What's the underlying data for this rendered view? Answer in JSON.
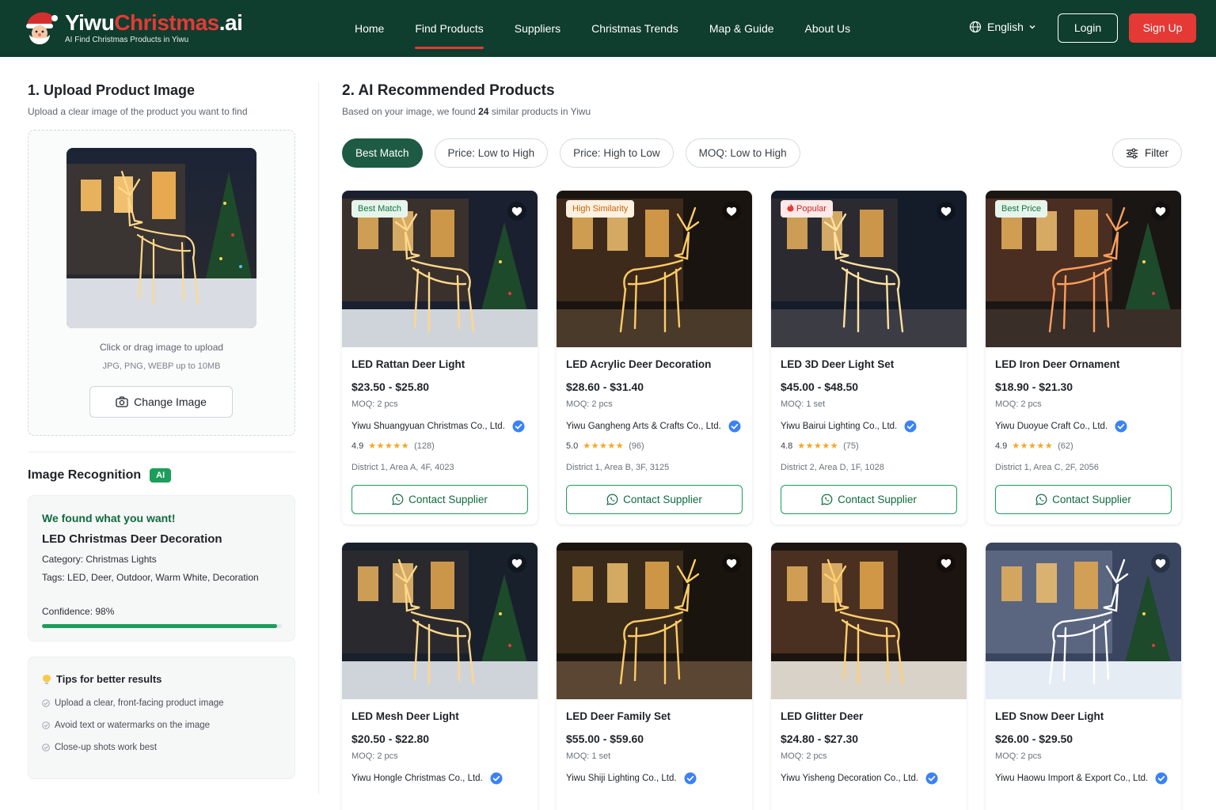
{
  "header": {
    "logo_part1": "Yiwu",
    "logo_part2": "Christmas",
    "logo_part3": ".ai",
    "logo_sub": "AI Find Christmas Products in Yiwu",
    "nav": [
      {
        "label": "Home"
      },
      {
        "label": "Find Products"
      },
      {
        "label": "Suppliers"
      },
      {
        "label": "Christmas Trends"
      },
      {
        "label": "Map & Guide"
      },
      {
        "label": "About Us"
      }
    ],
    "active_nav": "Find Products",
    "language": "English",
    "login": "Login",
    "signup": "Sign Up"
  },
  "upload": {
    "title": "1. Upload Product Image",
    "subtitle": "Upload a clear image of the product you want to find",
    "hint": "Click or drag image to upload",
    "formats": "JPG, PNG, WEBP up to 10MB",
    "change_button": "Change Image"
  },
  "recognition": {
    "title": "Image Recognition",
    "badge": "AI",
    "found": "We found what you want!",
    "product_name": "LED Christmas Deer Decoration",
    "category": "Category: Christmas Lights",
    "tags": "Tags: LED, Deer, Outdoor, Warm White, Decoration",
    "confidence_label": "Confidence: 98%",
    "confidence_value": 0.98
  },
  "tips": {
    "title": "Tips for better results",
    "items": [
      {
        "text": "Upload a clear, front-facing product image"
      },
      {
        "text": "Avoid text or watermarks on the image"
      },
      {
        "text": "Close-up shots work best"
      }
    ]
  },
  "results": {
    "title": "2. AI Recommended Products",
    "subtitle_prefix": "Based on your image, we found",
    "count": "24",
    "subtitle_suffix": "similar products in Yiwu",
    "sort_options": [
      {
        "label": "Best Match"
      },
      {
        "label": "Price: Low to High"
      },
      {
        "label": "Price: High to Low"
      },
      {
        "label": "MOQ: Low to High"
      }
    ],
    "active_sort": "Best Match",
    "filter_label": "Filter",
    "contact_label": "Contact Supplier"
  },
  "products": [
    {
      "name": "LED Rattan Deer Light",
      "price": "$23.50 - $25.80",
      "moq": "MOQ: 2 pcs",
      "supplier": "Yiwu Shuangyuan Christmas Co., Ltd.",
      "rating": "4.9",
      "stars": "★★★★★",
      "reviews": "(128)",
      "location": "District 1, Area A, 4F, 4023",
      "badge": "Best Match",
      "badge_style": "green"
    },
    {
      "name": "LED Acrylic Deer Decoration",
      "price": "$28.60 - $31.40",
      "moq": "MOQ: 2 pcs",
      "supplier": "Yiwu Gangheng Arts & Crafts Co., Ltd.",
      "rating": "5.0",
      "stars": "★★★★★",
      "reviews": "(96)",
      "location": "District 1, Area B, 3F, 3125",
      "badge": "High Similarity",
      "badge_style": "orange"
    },
    {
      "name": "LED 3D Deer Light Set",
      "price": "$45.00 - $48.50",
      "moq": "MOQ: 1 set",
      "supplier": "Yiwu Bairui Lighting Co., Ltd.",
      "rating": "4.8",
      "stars": "★★★★★",
      "reviews": "(75)",
      "location": "District 2, Area D, 1F, 1028",
      "badge": "Popular",
      "badge_style": "red"
    },
    {
      "name": "LED Iron Deer Ornament",
      "price": "$18.90 - $21.30",
      "moq": "MOQ: 2 pcs",
      "supplier": "Yiwu Duoyue Craft Co., Ltd.",
      "rating": "4.9",
      "stars": "★★★★★",
      "reviews": "(62)",
      "location": "District 1, Area C, 2F, 2056",
      "badge": "Best Price",
      "badge_style": "green"
    },
    {
      "name": "LED Mesh Deer Light",
      "price": "$20.50 - $22.80",
      "moq": "MOQ: 2 pcs",
      "supplier": "Yiwu Hongle Christmas Co., Ltd."
    },
    {
      "name": "LED Deer Family Set",
      "price": "$55.00 - $59.60",
      "moq": "MOQ: 1 set",
      "supplier": "Yiwu Shiji Lighting Co., Ltd."
    },
    {
      "name": "LED Glitter Deer",
      "price": "$24.80 - $27.30",
      "moq": "MOQ: 2 pcs",
      "supplier": "Yiwu Yisheng Decoration Co., Ltd."
    },
    {
      "name": "LED Snow Deer Light",
      "price": "$26.00 - $29.50",
      "moq": "MOQ: 2 pcs",
      "supplier": "Yiwu Haowu Import & Export Co., Ltd."
    }
  ],
  "colors": {
    "header_bg": "#0f3d2e",
    "accent_red": "#e53935",
    "accent_green": "#1b9e5a",
    "active_chip": "#1d5b44",
    "star": "#f5a623",
    "verified": "#3b82f6"
  },
  "icons": [
    "santa-logo-icon",
    "globe-icon",
    "chevron-down-icon",
    "camera-icon",
    "lightbulb-icon",
    "check-circle-icon",
    "filter-icon",
    "heart-icon",
    "verified-icon",
    "whatsapp-icon",
    "fire-icon"
  ]
}
